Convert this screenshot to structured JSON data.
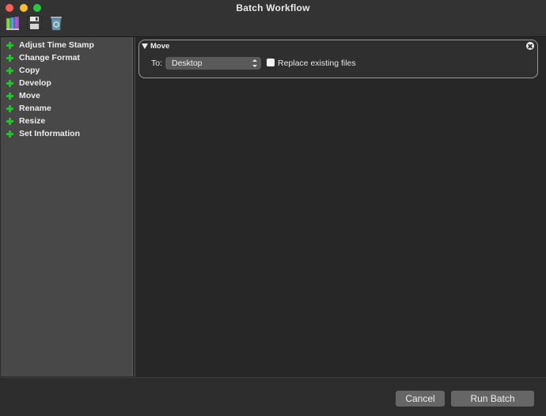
{
  "window": {
    "title": "Batch Workflow"
  },
  "toolbar": {
    "buttons": [
      {
        "icon": "library-books-icon"
      },
      {
        "icon": "floppy-save-icon"
      },
      {
        "icon": "trash-can-icon"
      }
    ]
  },
  "sidebar": {
    "items": [
      {
        "label": "Adjust Time Stamp",
        "icon": "plus-icon"
      },
      {
        "label": "Change Format",
        "icon": "plus-icon"
      },
      {
        "label": "Copy",
        "icon": "plus-icon"
      },
      {
        "label": "Develop",
        "icon": "plus-icon"
      },
      {
        "label": "Move",
        "icon": "plus-icon"
      },
      {
        "label": "Rename",
        "icon": "plus-icon"
      },
      {
        "label": "Resize",
        "icon": "plus-icon"
      },
      {
        "label": "Set Information",
        "icon": "plus-icon"
      }
    ]
  },
  "step": {
    "title": "Move",
    "to_label": "To:",
    "destination": "Desktop",
    "replace_label": "Replace existing files",
    "replace_checked": false
  },
  "footer": {
    "cancel_label": "Cancel",
    "run_label": "Run Batch"
  },
  "colors": {
    "close": "#fd5f57",
    "minimize": "#fcbc2e",
    "maximize": "#29c740",
    "plus": "#22c22e"
  }
}
